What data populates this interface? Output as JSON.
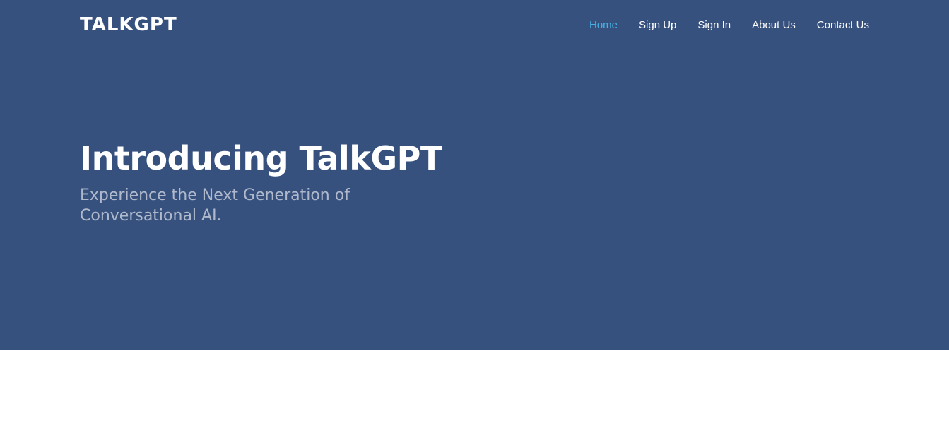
{
  "header": {
    "logo_text": "TALKGPT"
  },
  "nav": {
    "items": [
      {
        "label": "Home",
        "active": true
      },
      {
        "label": "Sign Up",
        "active": false
      },
      {
        "label": "Sign In",
        "active": false
      },
      {
        "label": "About Us",
        "active": false
      },
      {
        "label": "Contact Us",
        "active": false
      }
    ]
  },
  "hero": {
    "title": "Introducing TalkGPT",
    "subtitle": "Experience the Next Generation of Conversational AI."
  },
  "colors": {
    "hero_background": "#37517e",
    "nav_active": "#47b2e4",
    "nav_text": "#ffffff",
    "page_background": "#ffffff"
  }
}
